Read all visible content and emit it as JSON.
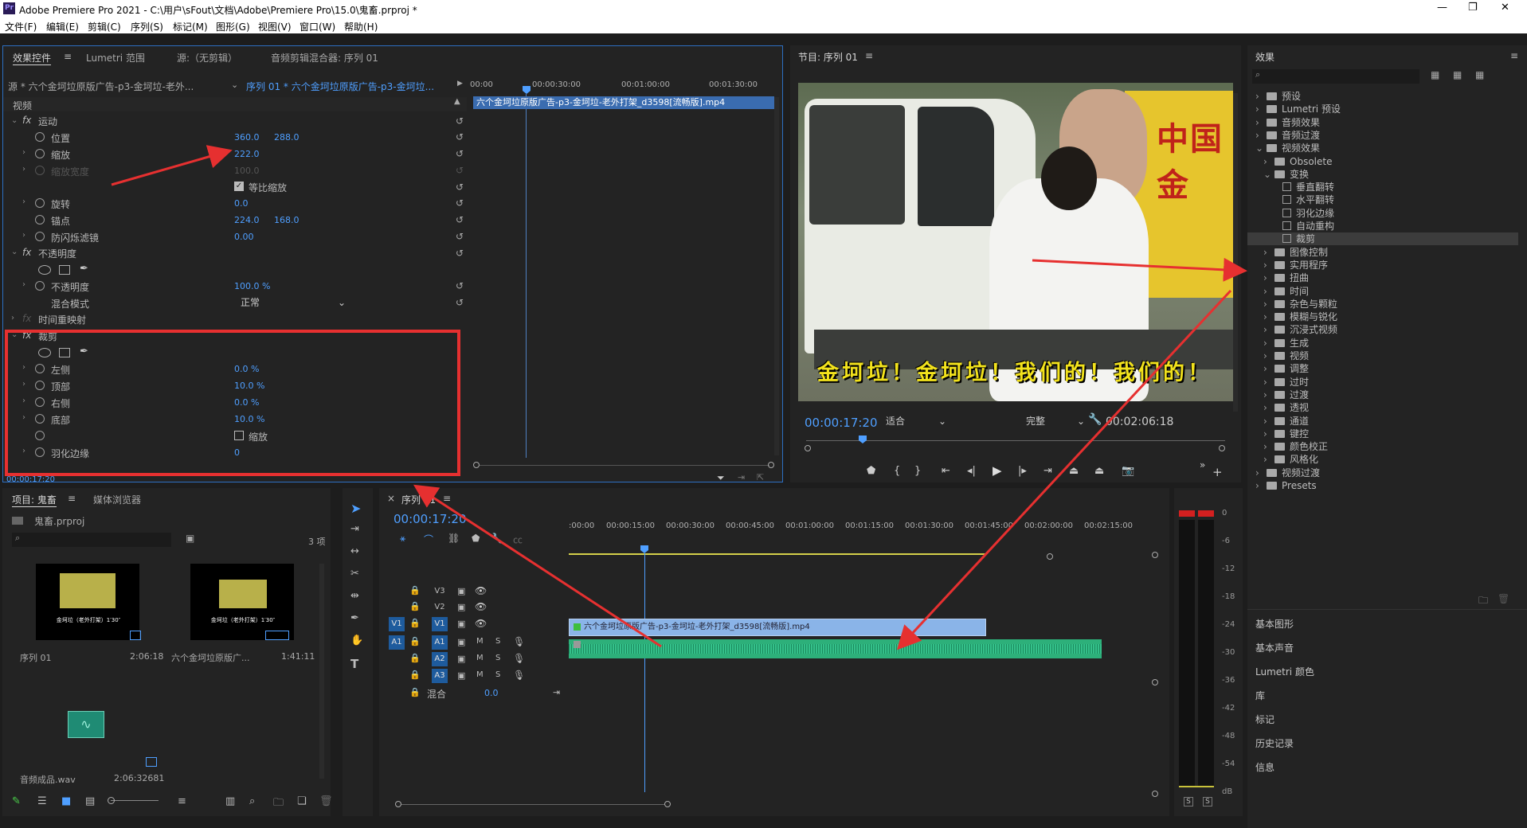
{
  "app": {
    "title": "Adobe Premiere Pro 2021 - C:\\用户\\sFout\\文档\\Adobe\\Premiere Pro\\15.0\\鬼畜.prproj *",
    "logo": "Pr"
  },
  "menu": [
    "文件(F)",
    "编辑(E)",
    "剪辑(C)",
    "序列(S)",
    "标记(M)",
    "图形(G)",
    "视图(V)",
    "窗口(W)",
    "帮助(H)"
  ],
  "effect_controls": {
    "tabs": [
      "效果控件",
      "Lumetri 范围",
      "源:（无剪辑）",
      "音频剪辑混合器: 序列 01"
    ],
    "source": "源 * 六个金坷垃原版广告-p3-金坷垃-老外...",
    "sequence": "序列 01 * 六个金坷垃原版广告-p3-金坷垃...",
    "clip_name": "六个金坷垃原版广告-p3-金坷垃-老外打架_d3598[流畅版].mp4",
    "ruler": [
      "00:00",
      "00:00:30:00",
      "00:01:00:00",
      "00:01:30:00"
    ],
    "video_header": "视频",
    "motion": "运动",
    "position_label": "位置",
    "position_x": "360.0",
    "position_y": "288.0",
    "scale_label": "缩放",
    "scale_value": "222.0",
    "scale_width_label": "缩放宽度",
    "scale_width_value": "100.0",
    "uniform_scale": "等比缩放",
    "rotation_label": "旋转",
    "rotation_value": "0.0",
    "anchor_label": "锚点",
    "anchor_x": "224.0",
    "anchor_y": "168.0",
    "antiflicker_label": "防闪烁滤镜",
    "antiflicker_value": "0.00",
    "opacity_header": "不透明度",
    "opacity_label": "不透明度",
    "opacity_value": "100.0 %",
    "blend_label": "混合模式",
    "blend_value": "正常",
    "time_remap": "时间重映射",
    "crop_header": "裁剪",
    "crop_left_label": "左侧",
    "crop_left": "0.0 %",
    "crop_top_label": "顶部",
    "crop_top": "10.0 %",
    "crop_right_label": "右侧",
    "crop_right": "0.0 %",
    "crop_bottom_label": "底部",
    "crop_bottom": "10.0 %",
    "crop_zoom": "缩放",
    "feather_label": "羽化边缘",
    "feather_value": "0",
    "timecode": "00:00:17:20"
  },
  "program": {
    "title": "节目: 序列 01",
    "timecode": "00:00:17:20",
    "fit": "适合",
    "quality": "完整",
    "duration": "00:02:06:18",
    "caption": "金坷垃！金坷垃！我们的！我们的！",
    "sign_text": "中国金"
  },
  "project": {
    "tabs": [
      "项目: 鬼畜",
      "媒体浏览器"
    ],
    "file": "鬼畜.prproj",
    "count": "3 项",
    "items": [
      {
        "name": "序列 01",
        "duration": "2:06:18",
        "thumb_text": "金坷垃（老外打架）1′30″"
      },
      {
        "name": "六个金坷垃原版广...",
        "duration": "1:41:11",
        "thumb_text": "金坷垃（老外打架）1′30″"
      },
      {
        "name": "音频成品.wav",
        "duration": "2:06:32681"
      }
    ]
  },
  "timeline": {
    "tab": "序列 01",
    "timecode": "00:00:17:20",
    "ruler": [
      ":00:00",
      "00:00:15:00",
      "00:00:30:00",
      "00:00:45:00",
      "00:01:00:00",
      "00:01:15:00",
      "00:01:30:00",
      "00:01:45:00",
      "00:02:00:00",
      "00:02:15:00"
    ],
    "tracks": [
      "V3",
      "V2",
      "V1",
      "A1",
      "A2",
      "A3"
    ],
    "mix_label": "混合",
    "mix_value": "0.0",
    "video_clip": "六个金坷垃原版广告-p3-金坷垃-老外打架_d3598[流畅版].mp4",
    "playhead_fraction": 0.125,
    "video_clip_end_fraction": 0.69,
    "audio_clip_end_fraction": 0.88
  },
  "meter": {
    "scale": [
      "0",
      "-6",
      "-12",
      "-18",
      "-24",
      "-30",
      "-36",
      "-42",
      "-48",
      "-54",
      "dB"
    ],
    "solo": [
      "S",
      "S"
    ]
  },
  "effects": {
    "title": "效果",
    "tree": [
      {
        "label": "预设",
        "level": 0,
        "type": "folder"
      },
      {
        "label": "Lumetri 预设",
        "level": 0,
        "type": "folder"
      },
      {
        "label": "音频效果",
        "level": 0,
        "type": "folder"
      },
      {
        "label": "音频过渡",
        "level": 0,
        "type": "folder"
      },
      {
        "label": "视频效果",
        "level": 0,
        "type": "folder",
        "open": true
      },
      {
        "label": "Obsolete",
        "level": 1,
        "type": "folder"
      },
      {
        "label": "变换",
        "level": 1,
        "type": "folder",
        "open": true
      },
      {
        "label": "垂直翻转",
        "level": 2,
        "type": "fx"
      },
      {
        "label": "水平翻转",
        "level": 2,
        "type": "fx"
      },
      {
        "label": "羽化边缘",
        "level": 2,
        "type": "fx"
      },
      {
        "label": "自动重构",
        "level": 2,
        "type": "fx"
      },
      {
        "label": "裁剪",
        "level": 2,
        "type": "fx",
        "selected": true
      },
      {
        "label": "图像控制",
        "level": 1,
        "type": "folder"
      },
      {
        "label": "实用程序",
        "level": 1,
        "type": "folder"
      },
      {
        "label": "扭曲",
        "level": 1,
        "type": "folder"
      },
      {
        "label": "时间",
        "level": 1,
        "type": "folder"
      },
      {
        "label": "杂色与颗粒",
        "level": 1,
        "type": "folder"
      },
      {
        "label": "模糊与锐化",
        "level": 1,
        "type": "folder"
      },
      {
        "label": "沉浸式视频",
        "level": 1,
        "type": "folder"
      },
      {
        "label": "生成",
        "level": 1,
        "type": "folder"
      },
      {
        "label": "视频",
        "level": 1,
        "type": "folder"
      },
      {
        "label": "调整",
        "level": 1,
        "type": "folder"
      },
      {
        "label": "过时",
        "level": 1,
        "type": "folder"
      },
      {
        "label": "过渡",
        "level": 1,
        "type": "folder"
      },
      {
        "label": "透视",
        "level": 1,
        "type": "folder"
      },
      {
        "label": "通道",
        "level": 1,
        "type": "folder"
      },
      {
        "label": "键控",
        "level": 1,
        "type": "folder"
      },
      {
        "label": "颜色校正",
        "level": 1,
        "type": "folder"
      },
      {
        "label": "风格化",
        "level": 1,
        "type": "folder"
      },
      {
        "label": "视频过渡",
        "level": 0,
        "type": "folder"
      },
      {
        "label": "Presets",
        "level": 0,
        "type": "folder"
      }
    ],
    "sections": [
      "基本图形",
      "基本声音",
      "Lumetri 颜色",
      "库",
      "标记",
      "历史记录",
      "信息"
    ]
  },
  "colors": {
    "accent": "#4f9fff",
    "annotation": "#e63030",
    "clip_video": "#8ab4e8",
    "clip_audio": "#2db07a"
  }
}
